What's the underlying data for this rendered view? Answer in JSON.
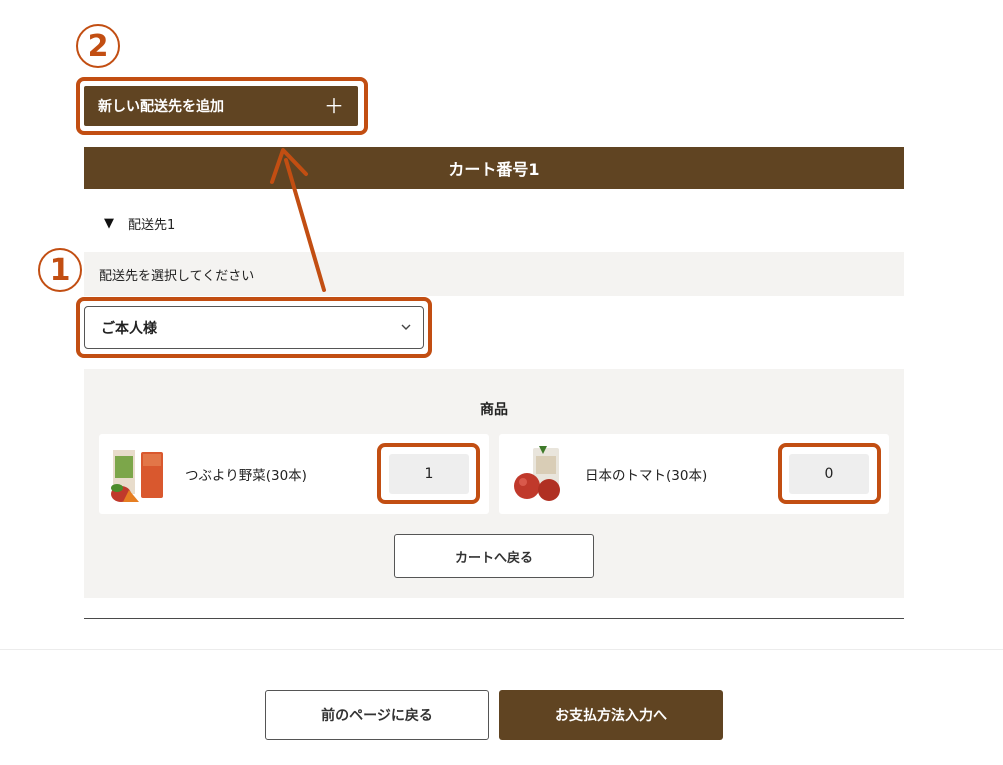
{
  "annotations": {
    "step_1": "1",
    "step_2": "2",
    "accent_color": "#c24e12"
  },
  "add_address": {
    "label": "新しい配送先を追加",
    "icon": "plus-icon"
  },
  "cart": {
    "header": "カート番号1",
    "address_toggle": "配送先1",
    "select_label": "配送先を選択してください",
    "selected_address": "ご本人様"
  },
  "products": {
    "title": "商品",
    "items": [
      {
        "name": "つぶより野菜(30本)",
        "quantity": "1",
        "image": "vegetable-juice-product-image"
      },
      {
        "name": "日本のトマト(30本)",
        "quantity": "0",
        "image": "tomato-juice-product-image"
      }
    ],
    "back_to_cart": "カートへ戻る"
  },
  "footer": {
    "prev_label": "前のページに戻る",
    "next_label": "お支払方法入力へ"
  },
  "colors": {
    "brand": "#604422",
    "panel": "#f4f3f1"
  }
}
